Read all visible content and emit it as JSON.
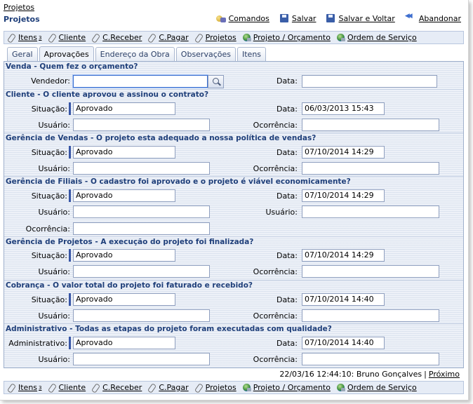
{
  "breadcrumb": "Projetos",
  "page_title": "Projetos",
  "actions": {
    "comandos": "Comandos",
    "salvar": "Salvar",
    "salvar_voltar": "Salvar e Voltar",
    "abandonar": "Abandonar"
  },
  "linkbar": {
    "itens": "Itens",
    "itens_count": "3",
    "cliente": "Cliente",
    "creceber": "C.Receber",
    "cpagar": "C.Pagar",
    "projetos": "Projetos",
    "projeto_orcamento": "Projeto / Orçamento",
    "ordem_servico": "Ordem de Serviço"
  },
  "tabs": [
    "Geral",
    "Aprovações",
    "Endereço da Obra",
    "Observações",
    "Itens"
  ],
  "sections": {
    "venda": {
      "title": "Venda - Quem fez o orçamento?",
      "vendedor_label": "Vendedor:",
      "vendedor_value": "",
      "data_label": "Data:",
      "data_value": ""
    },
    "cliente": {
      "title": "Cliente - O cliente aprovou e assinou o contrato?",
      "situacao_label": "Situação:",
      "situacao_value": "Aprovado",
      "data_label": "Data:",
      "data_value": "06/03/2013 15:43",
      "usuario_label": "Usuário:",
      "usuario_value": "",
      "ocorrencia_label": "Ocorrência:",
      "ocorrencia_value": ""
    },
    "gerencia_vendas": {
      "title": "Gerência de Vendas - O projeto esta adequado a nossa política de vendas?",
      "situacao_label": "Situação:",
      "situacao_value": "Aprovado",
      "data_label": "Data:",
      "data_value": "07/10/2014 14:29",
      "usuario_label": "Usuário:",
      "usuario_value": "",
      "ocorrencia_label": "Ocorrência:",
      "ocorrencia_value": ""
    },
    "gerencia_filiais": {
      "title": "Gerência de Filiais - O cadastro foi aprovado e o projeto é viável economicamente?",
      "situacao_label": "Situação:",
      "situacao_value": "Aprovado",
      "data_label": "Data:",
      "data_value": "07/10/2014 14:29",
      "usuario_label": "Usuário:",
      "usuario_value": "",
      "usuario2_label": "Usuário:",
      "usuario2_value": "",
      "ocorrencia_label": "Ocorrência:",
      "ocorrencia_value": ""
    },
    "gerencia_projetos": {
      "title": "Gerência de Projetos - A execução do projeto foi finalizada?",
      "situacao_label": "Situação:",
      "situacao_value": "Aprovado",
      "data_label": "Data:",
      "data_value": "07/10/2014 14:29",
      "usuario_label": "Usuário:",
      "usuario_value": "",
      "ocorrencia_label": "Ocorrência:",
      "ocorrencia_value": ""
    },
    "cobranca": {
      "title": "Cobrança - O valor total do projeto foi faturado e recebido?",
      "situacao_label": "Situação:",
      "situacao_value": "Aprovado",
      "data_label": "Data:",
      "data_value": "07/10/2014 14:40",
      "usuario_label": "Usuário:",
      "usuario_value": "",
      "ocorrencia_label": "Ocorrência:",
      "ocorrencia_value": ""
    },
    "administrativo": {
      "title": "Administrativo - Todas as etapas do projeto foram executadas com qualidade?",
      "adm_label": "Administrativo:",
      "adm_value": "Aprovado",
      "data_label": "Data:",
      "data_value": "07/10/2014 14:40",
      "usuario_label": "Usuário:",
      "usuario_value": "",
      "ocorrencia_label": "Ocorrência:",
      "ocorrencia_value": ""
    }
  },
  "footer": {
    "info": "22/03/16 12:44:10: Bruno Gonçalves",
    "separator": "|",
    "next": "Próximo"
  },
  "colors": {
    "title_blue": "#1f3f7a",
    "panel_bg": "#edf1f8",
    "required_marker": "#3856a6"
  }
}
